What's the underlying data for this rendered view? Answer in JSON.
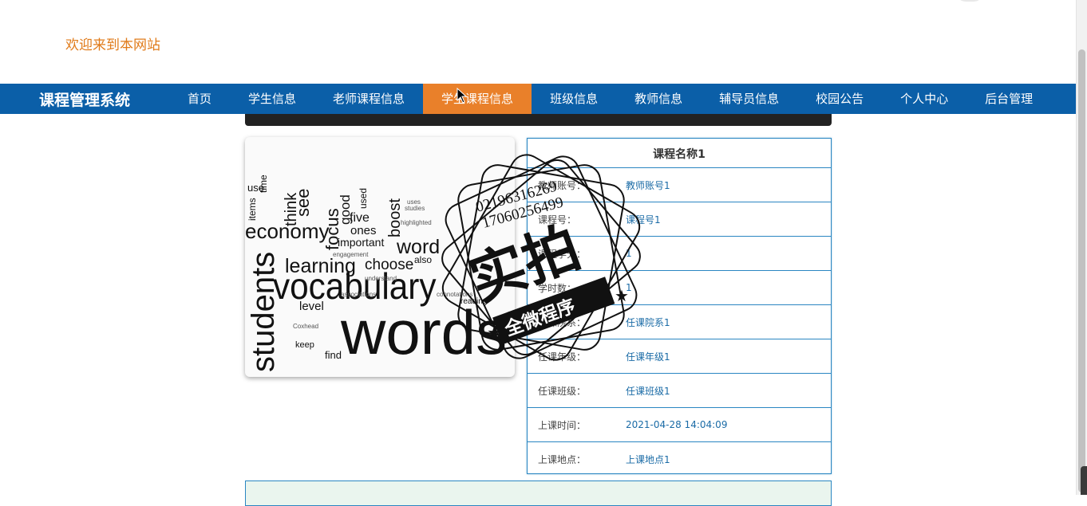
{
  "header": {
    "welcome": "欢迎来到本网站"
  },
  "nav": {
    "brand": "课程管理系统",
    "items": [
      "首页",
      "学生信息",
      "老师课程信息",
      "学生课程信息",
      "班级信息",
      "教师信息",
      "辅导员信息",
      "校园公告",
      "个人中心",
      "后台管理"
    ],
    "active_index": 3,
    "color": "#0b5fa8",
    "active_color": "#e9802a"
  },
  "course": {
    "title": "课程名称1",
    "rows": [
      {
        "label": "教师账号：",
        "value": "教师账号1"
      },
      {
        "label": "课程号：",
        "value": "课程号1"
      },
      {
        "label": "课程学分：",
        "value": "1"
      },
      {
        "label": "学时数：",
        "value": "1"
      },
      {
        "label": "任课院系：",
        "value": "任课院系1"
      },
      {
        "label": "任课年级：",
        "value": "任课年级1"
      },
      {
        "label": "任课班级：",
        "value": "任课班级1"
      },
      {
        "label": "上课时间：",
        "value": "2021-04-28 14:04:09"
      },
      {
        "label": "上课地点：",
        "value": "上课地点1"
      }
    ]
  },
  "image": {
    "words": [
      "vocabulary",
      "words",
      "students",
      "economy",
      "learning",
      "focus",
      "choose",
      "word",
      "boost",
      "level",
      "important",
      "five",
      "ones",
      "find",
      "keep",
      "see",
      "think",
      "good",
      "use",
      "time",
      "items",
      "used",
      "reading",
      "also"
    ]
  },
  "stamp": {
    "phone1": "02196316269",
    "phone2": "17060256499",
    "main": "实拍",
    "ribbon": "全微程序"
  }
}
